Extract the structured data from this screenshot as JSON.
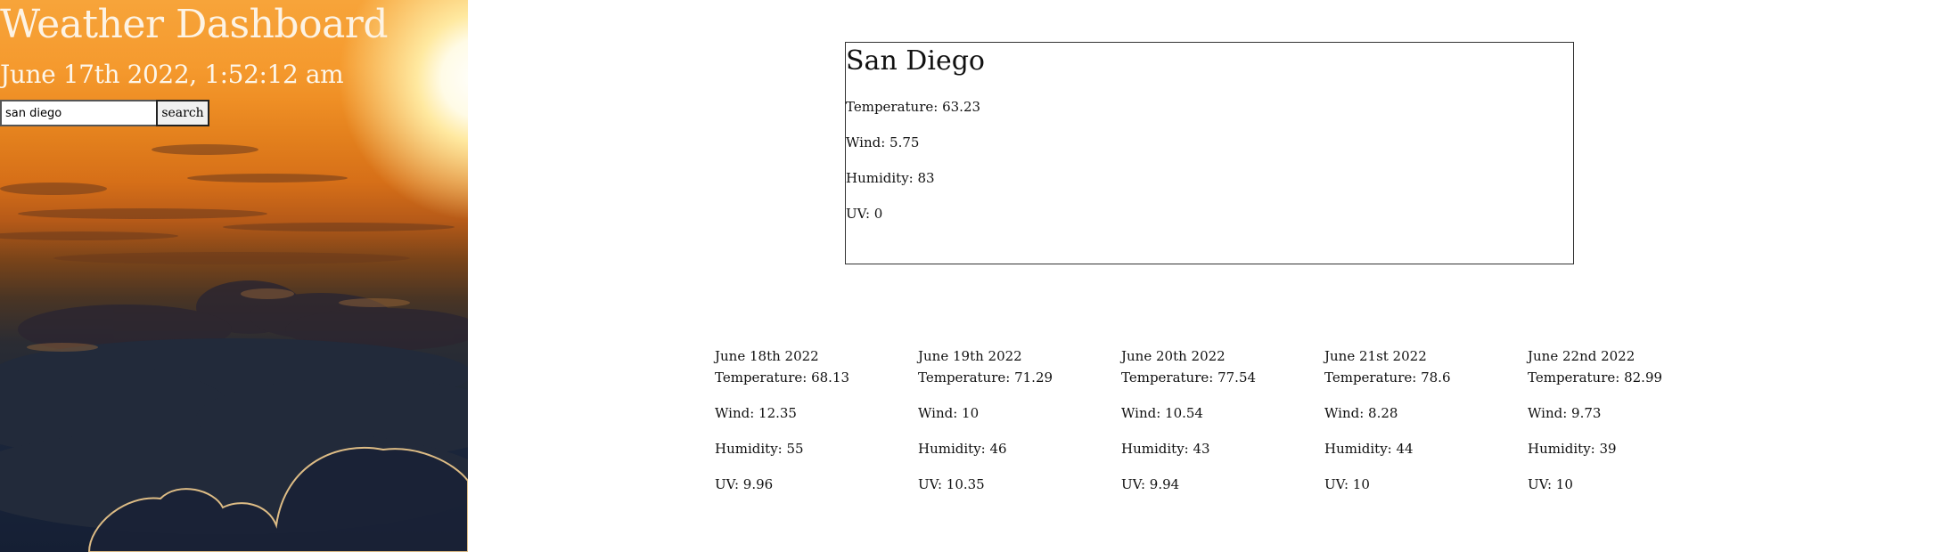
{
  "header": {
    "title": "Weather Dashboard",
    "datetime": "June 17th 2022, 1:52:12 am"
  },
  "search": {
    "value": "san diego",
    "button_label": "search"
  },
  "current": {
    "city": "San Diego",
    "temperature": "Temperature: 63.23",
    "wind": "Wind: 5.75",
    "humidity": "Humidity: 83",
    "uv": "UV: 0"
  },
  "forecast": [
    {
      "date": "June 18th 2022",
      "temperature": "Temperature: 68.13",
      "wind": "Wind: 12.35",
      "humidity": "Humidity: 55",
      "uv": "UV: 9.96"
    },
    {
      "date": "June 19th 2022",
      "temperature": "Temperature: 71.29",
      "wind": "Wind: 10",
      "humidity": "Humidity: 46",
      "uv": "UV: 10.35"
    },
    {
      "date": "June 20th 2022",
      "temperature": "Temperature: 77.54",
      "wind": "Wind: 10.54",
      "humidity": "Humidity: 43",
      "uv": "UV: 9.94"
    },
    {
      "date": "June 21st 2022",
      "temperature": "Temperature: 78.6",
      "wind": "Wind: 8.28",
      "humidity": "Humidity: 44",
      "uv": "UV: 10"
    },
    {
      "date": "June 22nd 2022",
      "temperature": "Temperature: 82.99",
      "wind": "Wind: 9.73",
      "humidity": "Humidity: 39",
      "uv": "UV: 10"
    }
  ],
  "colors": {
    "sky_top": "#f7a43a",
    "sky_bottom": "#151f34",
    "card_border": "#333333"
  }
}
